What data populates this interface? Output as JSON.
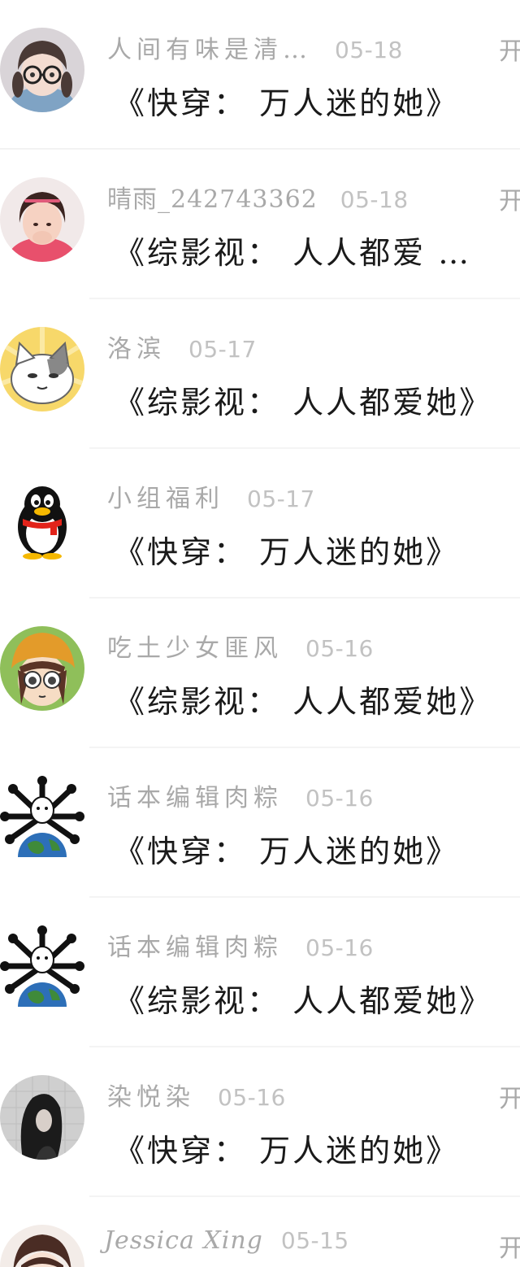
{
  "messages": [
    {
      "name": "人间有味是清…",
      "date": "05-18",
      "title": "《快穿： 万人迷的她》",
      "action": "开",
      "avatar_icon": "girl-glasses-avatar"
    },
    {
      "name": "晴雨_242743362",
      "date": "05-18",
      "title": "《综影视： 人人都爱 …",
      "action": "开",
      "avatar_icon": "girl-pink-avatar"
    },
    {
      "name": "洛滨",
      "date": "05-17",
      "title": "《综影视： 人人都爱她》",
      "action": "",
      "avatar_icon": "cartoon-cat-avatar"
    },
    {
      "name": "小组福利",
      "date": "05-17",
      "title": "《快穿： 万人迷的她》",
      "action": "",
      "avatar_icon": "qq-penguin-avatar"
    },
    {
      "name": "吃土少女匪风",
      "date": "05-16",
      "title": "《综影视： 人人都爱她》",
      "action": "",
      "avatar_icon": "anime-girl-hat-avatar"
    },
    {
      "name": "话本编辑肉粽",
      "date": "05-16",
      "title": "《快穿： 万人迷的她》",
      "action": "",
      "avatar_icon": "globe-bones-avatar"
    },
    {
      "name": "话本编辑肉粽",
      "date": "05-16",
      "title": "《综影视： 人人都爱她》",
      "action": "",
      "avatar_icon": "globe-bones-avatar"
    },
    {
      "name": "染悦染",
      "date": "05-16",
      "title": "《快穿： 万人迷的她》",
      "action": "开",
      "avatar_icon": "dark-hair-girl-avatar"
    },
    {
      "name": "Jessica Xing",
      "date": "05-15",
      "title": "",
      "action": "开",
      "avatar_icon": "anime-girl-avatar"
    }
  ],
  "colors": {
    "name_text": "#a9a9a9",
    "date_text": "#c2c2c2",
    "title_text": "#1a1a1a",
    "divider": "#f2f2f2",
    "background": "#ffffff"
  }
}
